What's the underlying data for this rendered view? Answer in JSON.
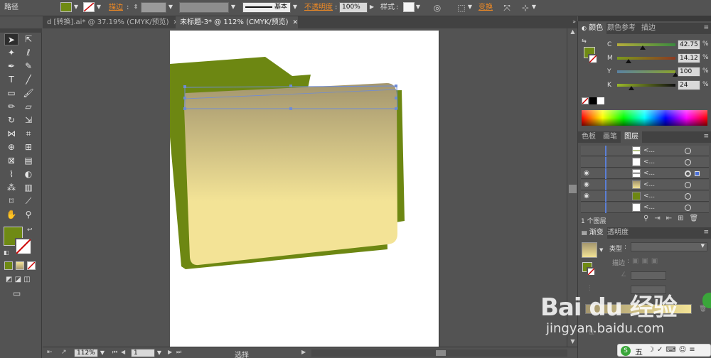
{
  "control_bar": {
    "object_label": "路径",
    "stroke_link": "描边",
    "stroke_style": "基本",
    "opacity_link": "不透明度",
    "opacity_value": "100%",
    "style_label": "样式",
    "transform_link": "变换"
  },
  "tabs": [
    {
      "label": "d [转换].ai* @ 37.19% (CMYK/预览)"
    },
    {
      "label": "未标题-3* @ 112% (CMYK/预览)"
    }
  ],
  "status_bar": {
    "zoom": "112%",
    "page": "1",
    "mode": "选择"
  },
  "color_panel": {
    "tabs": [
      "颜色",
      "颜色参考",
      "描边"
    ],
    "channels": [
      {
        "name": "C",
        "value": "42.75",
        "pct": "%"
      },
      {
        "name": "M",
        "value": "14.12",
        "pct": "%"
      },
      {
        "name": "Y",
        "value": "100",
        "pct": "%"
      },
      {
        "name": "K",
        "value": "24",
        "pct": "%"
      }
    ]
  },
  "layers_panel": {
    "tabs": [
      "色板",
      "画笔",
      "图层"
    ],
    "rows": [
      {
        "name": "<..."
      },
      {
        "name": "<..."
      },
      {
        "name": "<..."
      },
      {
        "name": "<..."
      },
      {
        "name": "<..."
      },
      {
        "name": "<..."
      }
    ],
    "footer": "1 个图层"
  },
  "gradient_panel": {
    "tabs": [
      "渐变",
      "透明度"
    ],
    "type_label": "类型",
    "stroke_label": "描边"
  },
  "watermark": {
    "brand": "Bai du 经验",
    "url": "jingyan.baidu.com"
  },
  "ime": {
    "label": "五"
  },
  "colors": {
    "fill": "#6f8a14",
    "folder_back": "#6d8712",
    "gradient_top": "#a4966e",
    "gradient_bottom": "#f3e396"
  }
}
